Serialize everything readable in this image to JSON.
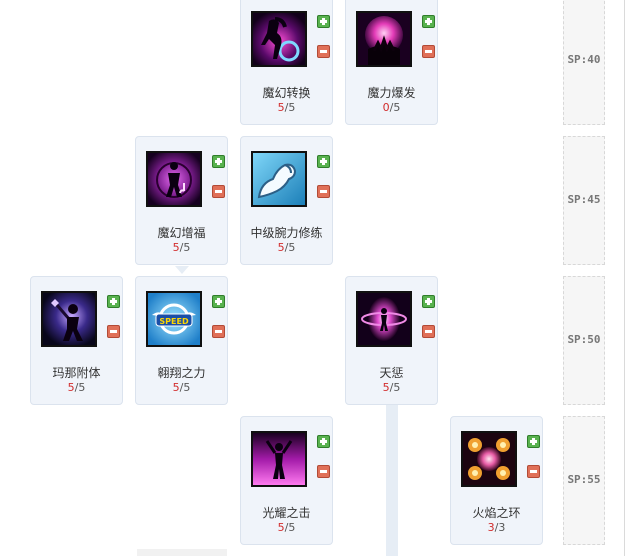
{
  "tiers": [
    {
      "sp_label": "SP:40"
    },
    {
      "sp_label": "SP:45"
    },
    {
      "sp_label": "SP:50"
    },
    {
      "sp_label": "SP:55"
    }
  ],
  "skills": [
    {
      "key": "magic-conversion",
      "name": "魔幻转换",
      "current": "5",
      "max": "5",
      "icon": "magic-conversion-icon"
    },
    {
      "key": "magic-burst",
      "name": "魔力爆发",
      "current": "0",
      "max": "5",
      "icon": "magic-burst-icon"
    },
    {
      "key": "magic-blessing",
      "name": "魔幻增福",
      "current": "5",
      "max": "5",
      "icon": "magic-blessing-icon"
    },
    {
      "key": "mid-arm-training",
      "name": "中级腕力修练",
      "current": "5",
      "max": "5",
      "icon": "arm-training-icon"
    },
    {
      "key": "mana-enchant",
      "name": "玛那附体",
      "current": "5",
      "max": "5",
      "icon": "mana-enchant-icon"
    },
    {
      "key": "soaring-power",
      "name": "翱翔之力",
      "current": "5",
      "max": "5",
      "icon": "speed-wings-icon",
      "icon_text": "SPEED"
    },
    {
      "key": "heavenly-punish",
      "name": "天惩",
      "current": "5",
      "max": "5",
      "icon": "heavenly-punish-icon"
    },
    {
      "key": "radiant-strike",
      "name": "光耀之击",
      "current": "5",
      "max": "5",
      "icon": "radiant-strike-icon"
    },
    {
      "key": "flame-ring",
      "name": "火焰之环",
      "current": "3",
      "max": "3",
      "icon": "flame-ring-icon"
    }
  ],
  "level_separator": "/",
  "colors": {
    "card_bg": "#f0f4fa",
    "card_border": "#dbe3ee",
    "plus_button": "#59b24f",
    "minus_button": "#e07058",
    "current_level": "#d22c2c",
    "connector": "#e6edf5"
  }
}
